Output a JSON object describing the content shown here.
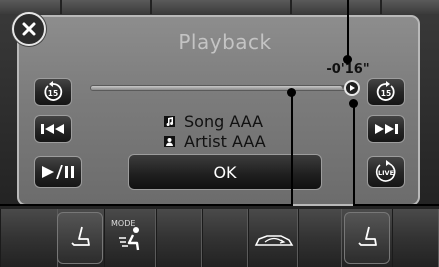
{
  "screen": {
    "title": "Playback",
    "time_remaining": "-0'16\"",
    "progress": 0.98
  },
  "track_info": {
    "song": "Song AAA",
    "artist": "Artist AAA"
  },
  "buttons": {
    "ok_label": "OK",
    "skip_back_15_label": "15",
    "skip_forward_15_label": "15",
    "live_label": "LIVE",
    "mode_label": "MODE"
  },
  "icons": {
    "close": "close-icon",
    "skip_back_15": "skip-back-15-icon",
    "skip_forward_15": "skip-forward-15-icon",
    "previous": "previous-track-icon",
    "next": "next-track-icon",
    "play_pause": "play-pause-icon",
    "live": "live-icon",
    "song": "note-icon",
    "artist": "person-icon",
    "seat_left": "seat-icon",
    "seat_right": "seat-icon",
    "mode": "airflow-mode-icon",
    "car": "car-recirculation-icon"
  },
  "colors": {
    "panel": "#7b7b7b",
    "panel_border": "#b9b9b9",
    "button": "#1f1f1f",
    "text_dark": "#111111",
    "title_text": "#c4c4c4"
  }
}
